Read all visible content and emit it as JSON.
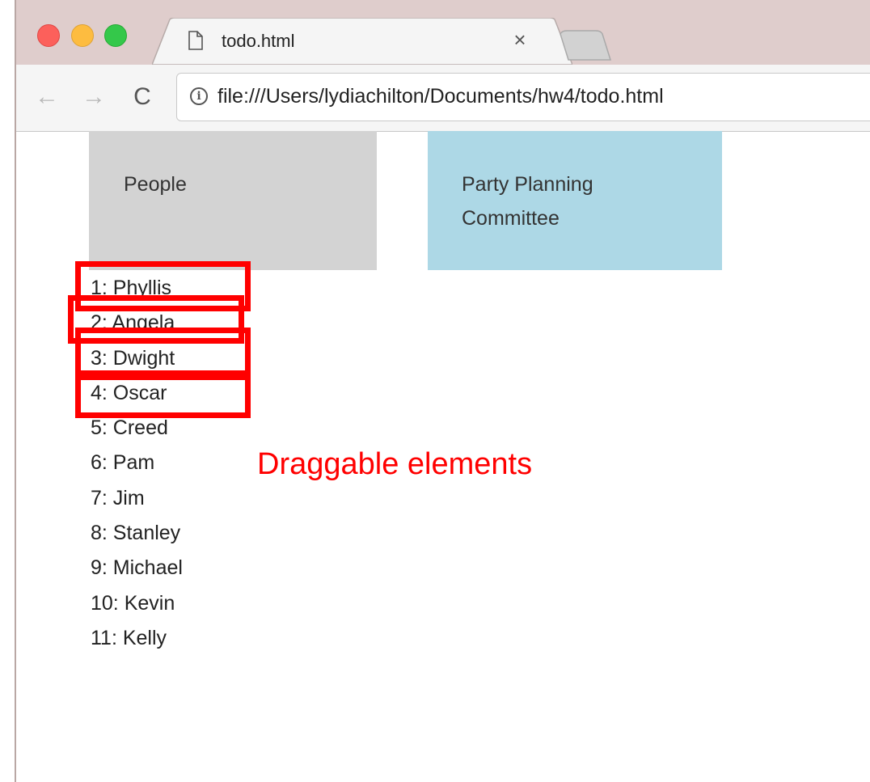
{
  "window": {
    "buttons": [
      "close",
      "minimize",
      "zoom"
    ]
  },
  "tab": {
    "title": "todo.html",
    "close_glyph": "×",
    "icon": "file-icon"
  },
  "toolbar": {
    "back_glyph": "←",
    "forward_glyph": "→",
    "reload_glyph": "C",
    "info_glyph": "i",
    "url": "file:///Users/lydiachilton/Documents/hw4/todo.html"
  },
  "boxes": {
    "people_label": "People",
    "committee_label": "Party Planning Committee"
  },
  "people": [
    "1: Phyllis",
    "2: Angela",
    "3: Dwight",
    "4: Oscar",
    "5: Creed",
    "6: Pam",
    "7: Jim",
    "8: Stanley",
    "9: Michael",
    "10: Kevin",
    "11: Kelly"
  ],
  "annotation": {
    "text": "Draggable elements",
    "color": "#ff0000"
  },
  "colors": {
    "people_box": "#d3d3d3",
    "committee_box": "#add8e6",
    "highlight": "#ff0000"
  }
}
